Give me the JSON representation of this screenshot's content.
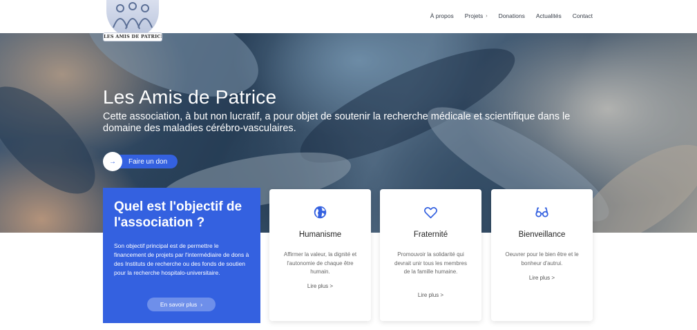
{
  "logo": {
    "text": "LES AMIS DE PATRICE"
  },
  "nav": [
    {
      "label": "À propos"
    },
    {
      "label": "Projets",
      "chevron": "›"
    },
    {
      "label": "Donations"
    },
    {
      "label": "Actualités"
    },
    {
      "label": "Contact"
    }
  ],
  "hero": {
    "title": "Les Amis de Patrice",
    "subtitle": "Cette association, à but non lucratif, a pour objet de soutenir la recherche médicale et scientifique dans le domaine des maladies cérébro-vasculaires.",
    "cta_label": "Faire un don",
    "cta_icon": "→"
  },
  "objective": {
    "title": "Quel est l'objectif de l'association ?",
    "text": "Son objectif principal est de permettre le financement de projets par l'intermédiaire de dons à des Instituts de recherche ou des fonds de soutien pour la recherche hospitalo-universitaire.",
    "button_label": "En savoir plus",
    "button_chevron": "›"
  },
  "values": [
    {
      "icon": "globe-icon",
      "title": "Humanisme",
      "text": "Affirmer la valeur, la dignité et l'autonomie de chaque être humain.",
      "more": "Lire plus >"
    },
    {
      "icon": "heart-icon",
      "title": "Fraternité",
      "text": "Promouvoir la solidarité qui devrait unir tous les membres de la famille humaine.",
      "more": "Lire plus >"
    },
    {
      "icon": "glasses-icon",
      "title": "Bienveillance",
      "text": "Oeuvrer pour le bien être et le bonheur d'autrui.",
      "more": "Lire plus >"
    }
  ],
  "colors": {
    "accent": "#3461e0",
    "button_light": "#6e8fea"
  }
}
